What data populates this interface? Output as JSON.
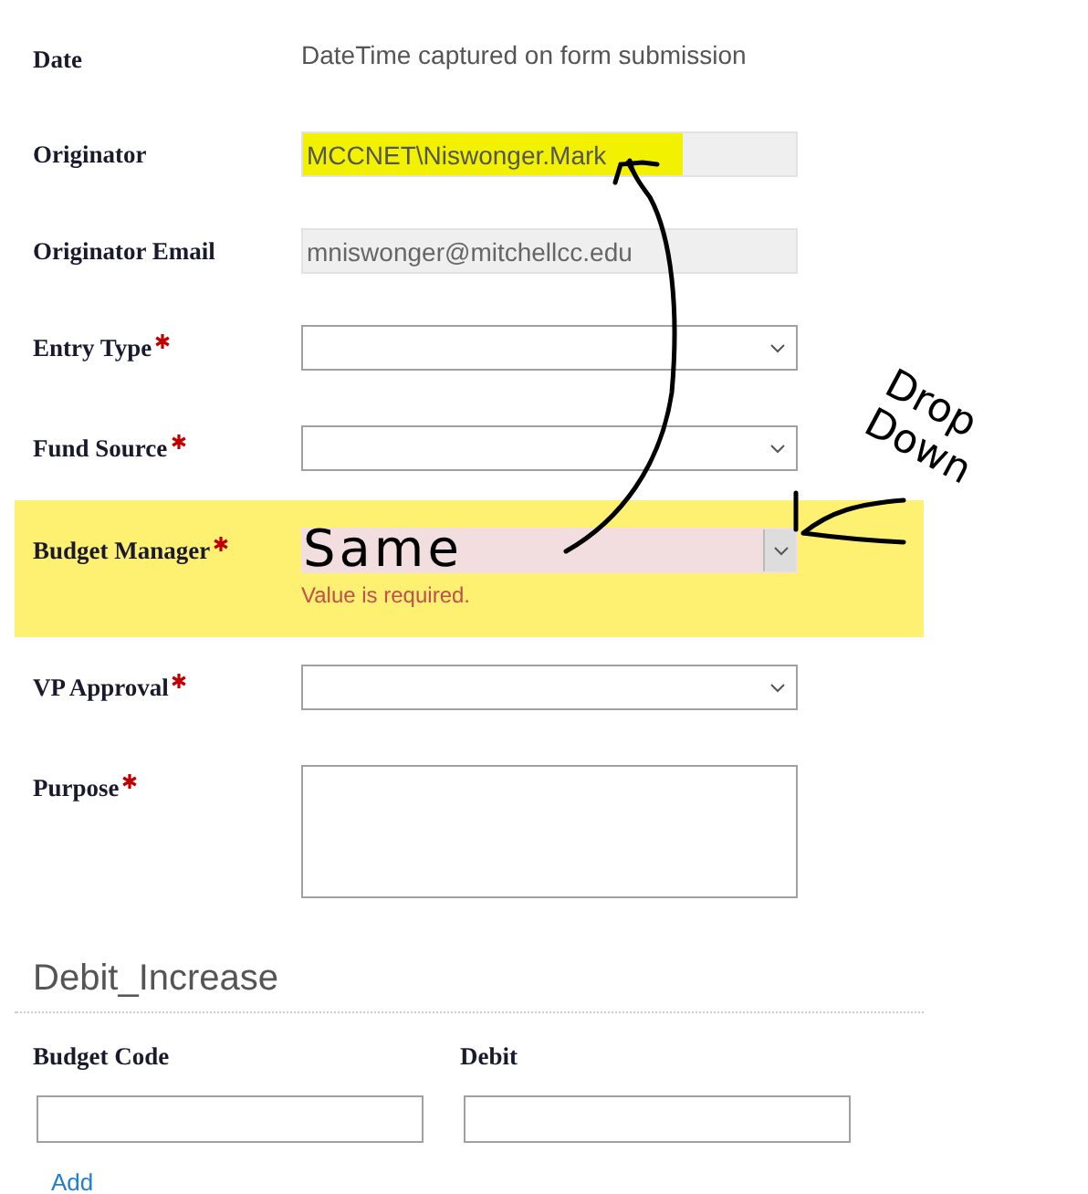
{
  "fields": [
    {
      "label": "Date",
      "kind": "static",
      "value": "DateTime captured on form submission",
      "required": false,
      "highlighted": false
    },
    {
      "label": "Originator",
      "kind": "readonly",
      "value": "MCCNET\\Niswonger.Mark",
      "required": false,
      "highlighted": true
    },
    {
      "label": "Originator Email",
      "kind": "readonly",
      "value": "mniswonger@mitchellcc.edu",
      "required": false,
      "highlighted": false
    },
    {
      "label": "Entry Type",
      "kind": "select",
      "required": true,
      "highlighted": false
    },
    {
      "label": "Fund Source",
      "kind": "select",
      "required": true,
      "highlighted": false
    },
    {
      "label": "Budget Manager",
      "kind": "select",
      "required": true,
      "highlighted": true,
      "error": "Value is required."
    },
    {
      "label": "VP Approval",
      "kind": "select",
      "required": true,
      "highlighted": false
    },
    {
      "label": "Purpose",
      "kind": "textarea",
      "required": true,
      "highlighted": false
    }
  ],
  "section": {
    "title": "Debit_Increase",
    "columns": [
      "Budget Code",
      "Debit"
    ],
    "link": "Add"
  },
  "annotations": [
    {
      "kind": "same",
      "text": "Same"
    },
    {
      "kind": "dropdown",
      "text": "Drop Down"
    }
  ]
}
